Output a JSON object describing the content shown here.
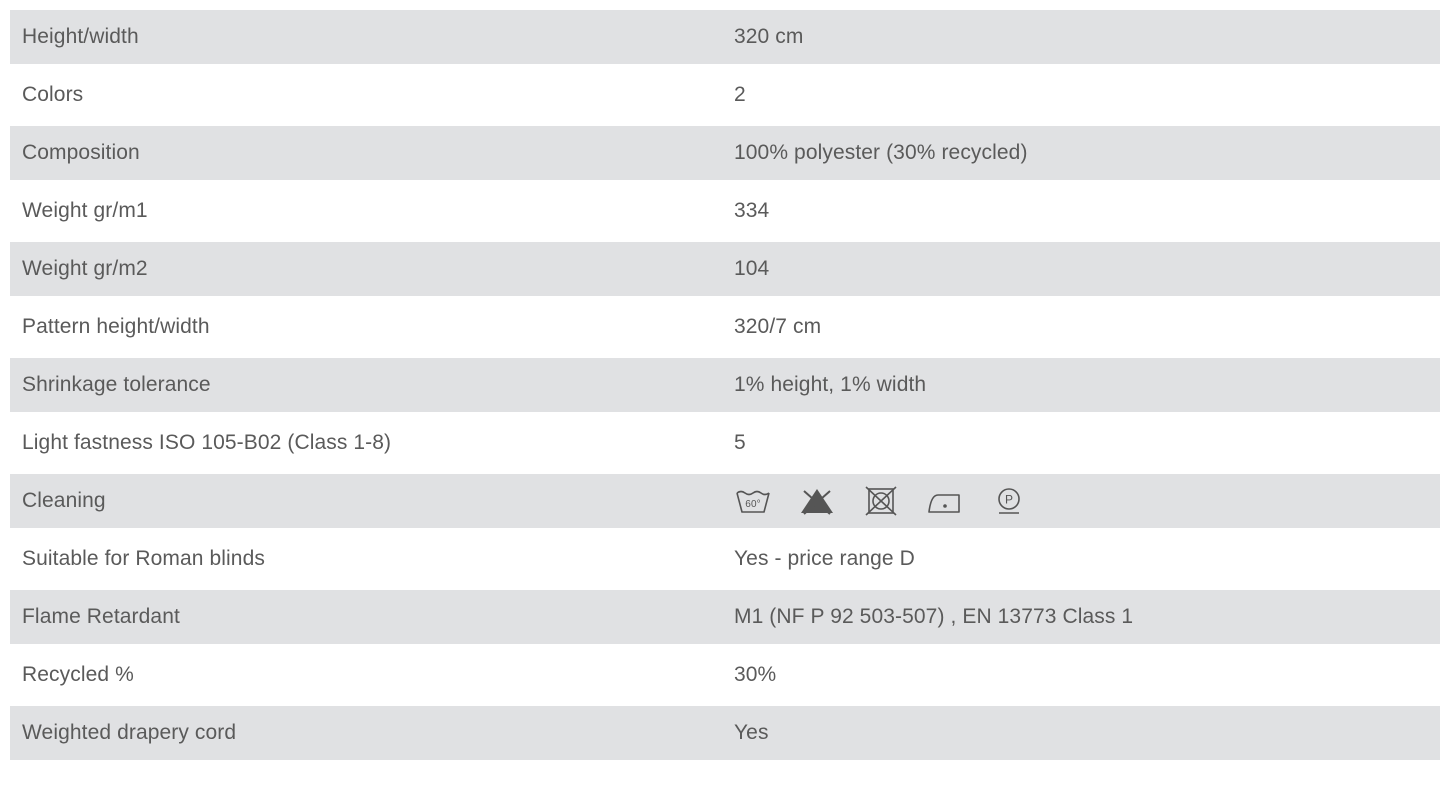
{
  "specs": {
    "rows": [
      {
        "label": "Height/width",
        "value": "320 cm"
      },
      {
        "label": "Colors",
        "value": "2"
      },
      {
        "label": "Composition",
        "value": "100% polyester (30% recycled)"
      },
      {
        "label": "Weight gr/m1",
        "value": "334"
      },
      {
        "label": "Weight gr/m2",
        "value": "104"
      },
      {
        "label": "Pattern height/width",
        "value": "320/7 cm"
      },
      {
        "label": "Shrinkage tolerance",
        "value": "1% height, 1% width"
      },
      {
        "label": "Light fastness ISO 105-B02 (Class 1-8)",
        "value": "5"
      },
      {
        "label": "Cleaning",
        "icons": [
          "wash-60-icon",
          "no-bleach-icon",
          "no-tumble-dry-icon",
          "iron-low-icon",
          "dry-clean-p-icon"
        ]
      },
      {
        "label": "Suitable for Roman blinds",
        "value": "Yes - price range D"
      },
      {
        "label": "Flame Retardant",
        "value": "M1 (NF P 92 503-507) , EN 13773 Class 1"
      },
      {
        "label": "Recycled %",
        "value": "30%"
      },
      {
        "label": "Weighted drapery cord",
        "value": "Yes"
      }
    ]
  },
  "care": {
    "wash_temp": "60°",
    "dry_clean_letter": "P"
  },
  "colors": {
    "row_shade": "#e0e1e3",
    "text": "#5a5a5a",
    "icon": "#555555"
  }
}
